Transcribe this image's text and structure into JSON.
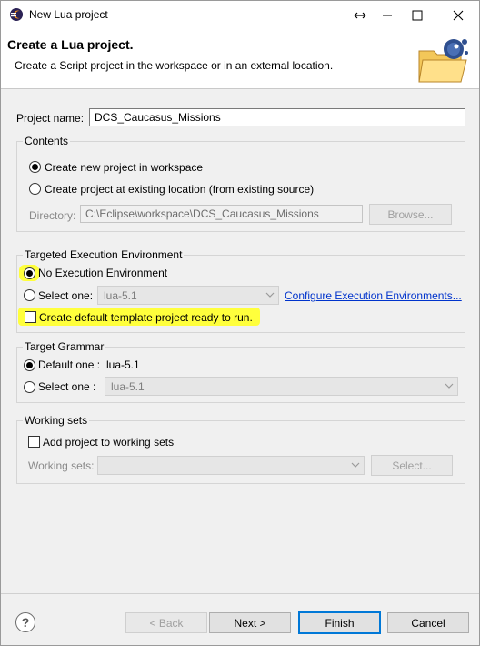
{
  "window": {
    "title": "New Lua project"
  },
  "header": {
    "title": "Create a Lua project.",
    "description": "Create a Script project in the workspace or in an external location."
  },
  "project_name": {
    "label": "Project name:",
    "value": "DCS_Caucasus_Missions"
  },
  "contents": {
    "title": "Contents",
    "option_new": "Create new project in workspace",
    "option_existing": "Create project at existing location (from existing source)",
    "directory_label": "Directory:",
    "directory_value": "C:\\Eclipse\\workspace\\DCS_Caucasus_Missions",
    "browse_label": "Browse..."
  },
  "exec_env": {
    "title": "Targeted Execution Environment",
    "option_none": "No Execution Environment",
    "option_select": "Select one:",
    "select_value": "lua-5.1",
    "configure_link": "Configure Execution Environments...",
    "template_checkbox": "Create default template project ready to run."
  },
  "grammar": {
    "title": "Target Grammar",
    "option_default": "Default one :",
    "default_value": "lua-5.1",
    "option_select": "Select one :",
    "select_value": "lua-5.1"
  },
  "working_sets": {
    "title": "Working sets",
    "checkbox": "Add project to working sets",
    "label": "Working sets:",
    "value": "",
    "select_button": "Select..."
  },
  "footer": {
    "help_glyph": "?",
    "back_label": "< Back",
    "next_label": "Next >",
    "finish_label": "Finish",
    "cancel_label": "Cancel"
  },
  "colors": {
    "highlight": "#ffff3c",
    "link": "#0033cc",
    "default_button_border": "#0078d7"
  },
  "icons": [
    "eclipse-icon",
    "resize-icon",
    "minimize-icon",
    "maximize-icon",
    "close-icon",
    "folder-wizard-icon",
    "chevron-down-icon",
    "help-icon"
  ]
}
